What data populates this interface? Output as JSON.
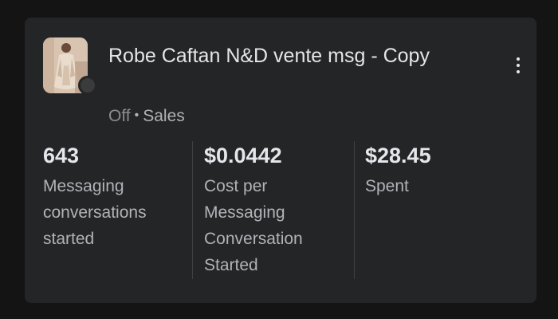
{
  "campaign": {
    "title": "Robe Caftan N&D vente msg - Copy",
    "status": "Off",
    "separator": "•",
    "category": "Sales"
  },
  "metrics": [
    {
      "value": "643",
      "label": "Messaging conversations started"
    },
    {
      "value": "$0.0442",
      "label": "Cost per Messaging Conversation Started"
    },
    {
      "value": "$28.45",
      "label": "Spent"
    }
  ],
  "icons": {
    "thumbnail": "campaign-thumbnail",
    "status_indicator": "status-off-dot",
    "more": "more-vertical-icon"
  },
  "colors": {
    "card_background": "#242526",
    "page_background": "#141414",
    "primary_text": "#e4e6eb",
    "secondary_text": "#b0b3b8",
    "status_off": "#8a8d91"
  }
}
